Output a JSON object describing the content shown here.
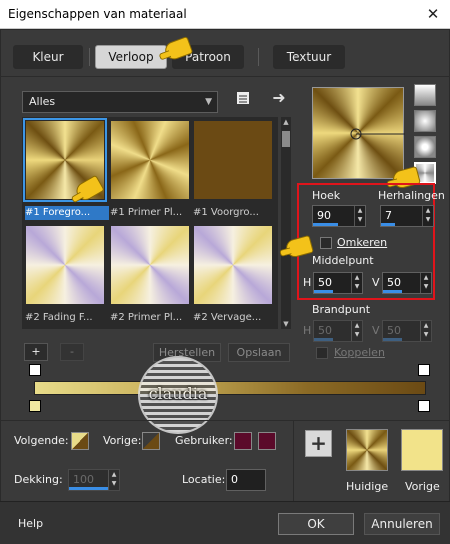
{
  "window": {
    "title": "Eigenschappen van materiaal",
    "close": "✕"
  },
  "tabs": [
    {
      "label": "Kleur",
      "active": false
    },
    {
      "label": "Verloop",
      "active": true
    },
    {
      "label": "Patroon",
      "active": false
    },
    {
      "label": "Textuur",
      "active": false
    }
  ],
  "library": {
    "category": "Alles",
    "items": [
      {
        "label": "#1 Foregro...",
        "selected": true,
        "style": "radial"
      },
      {
        "label": "#1 Primer Pl...",
        "selected": false,
        "style": "radial2"
      },
      {
        "label": "#1 Voorgro...",
        "selected": false,
        "style": "solid-brown"
      },
      {
        "label": "#2 Fading F...",
        "selected": false,
        "style": "fading"
      },
      {
        "label": "#2 Primer Pl...",
        "selected": false,
        "style": "fading"
      },
      {
        "label": "#2 Vervage...",
        "selected": false,
        "style": "fading"
      }
    ],
    "add_label": "+",
    "remove_label": "-",
    "restore_label": "Herstellen",
    "save_label": "Opslaan"
  },
  "settings": {
    "angle_label": "Hoek",
    "angle_value": "90",
    "repeat_label": "Herhalingen",
    "repeat_value": "7",
    "invert_label": "Omkeren",
    "invert_checked": false,
    "center_label": "Middelpunt",
    "center_h_label": "H",
    "center_h": "50",
    "center_v_label": "V",
    "center_v": "50",
    "focal_label": "Brandpunt",
    "focal_h_label": "H",
    "focal_h": "50",
    "focal_v_label": "V",
    "focal_v": "50",
    "link_label": "Koppelen"
  },
  "editor": {
    "next_label": "Volgende:",
    "prev_label": "Vorige:",
    "user_label": "Gebruiker:",
    "opacity_label": "Dekking:",
    "opacity_value": "100",
    "location_label": "Locatie:",
    "location_value": "0",
    "current_label": "Huidige",
    "previous_label": "Vorige",
    "add_label": "+",
    "logo_text": "claudia"
  },
  "colors": {
    "gold": "#e8dc8a",
    "brown": "#6b4a14",
    "user_fill": "#5b0a2a",
    "accent": "#3c96e6",
    "highlight_border": "#e0141b"
  },
  "footer": {
    "help": "Help",
    "ok": "OK",
    "cancel": "Annuleren"
  }
}
